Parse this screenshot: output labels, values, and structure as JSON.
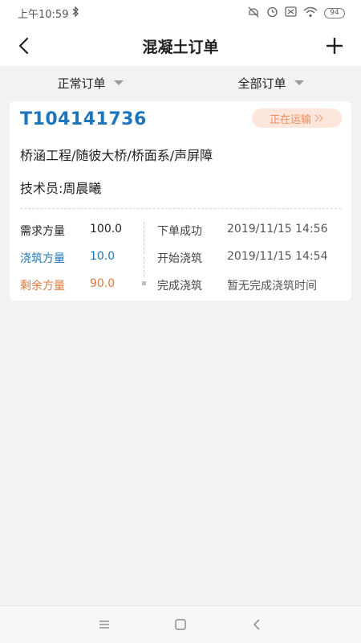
{
  "status": {
    "time": "上午10:59",
    "battery": "94"
  },
  "header": {
    "title": "混凝土订单"
  },
  "filters": {
    "left_label": "正常订单",
    "right_label": "全部订单"
  },
  "order": {
    "number": "T104141736",
    "status_badge": "正在运输",
    "project": "桥涵工程/随彼大桥/桥面系/声屏障",
    "technician": "技术员:周晨曦",
    "quantities": [
      {
        "label": "需求方量",
        "value": "100.0",
        "color": "#222222"
      },
      {
        "label": "浇筑方量",
        "value": "10.0",
        "color": "#1e75b9"
      },
      {
        "label": "剩余方量",
        "value": "90.0",
        "color": "#e0763a"
      }
    ],
    "timeline": [
      {
        "label": "下单成功",
        "time": "2019/11/15 14:56"
      },
      {
        "label": "开始浇筑",
        "time": "2019/11/15 14:54"
      },
      {
        "label": "完成浇筑",
        "time": "暂无完成浇筑时间"
      }
    ]
  },
  "colors": {
    "accent_blue": "#1e75b9",
    "accent_orange": "#e0763a",
    "badge_bg": "#fde6dc"
  },
  "icons": {
    "back": "back-arrow-icon",
    "add": "plus-icon",
    "dropdown": "triangle-down-icon",
    "badge_chevron": "double-chevron-right-icon"
  }
}
